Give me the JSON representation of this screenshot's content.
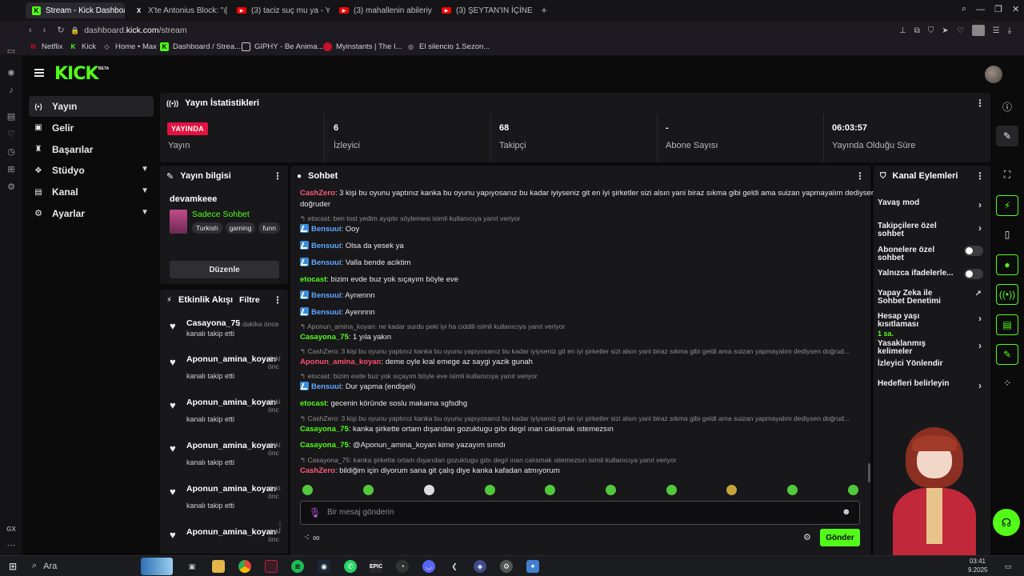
{
  "browser": {
    "tabs": [
      {
        "label": "Stream - Kick Dashboard",
        "favicon": "kick",
        "color": "#53fc18"
      },
      {
        "label": "X'te Antonius Block: \"@p",
        "favicon": "x",
        "color": "#ffffff"
      },
      {
        "label": "(3) taciz suç mu ya - You",
        "favicon": "youtube",
        "color": "#ff0000"
      },
      {
        "label": "(3) mahallenin abileriyik -",
        "favicon": "youtube",
        "color": "#ff0000"
      },
      {
        "label": "(3) ŞEYTAN'IN İÇİNE GİRD",
        "favicon": "youtube",
        "color": "#ff0000"
      }
    ],
    "url_host": "dashboard.",
    "url_domain": "kick.com",
    "url_path": "/stream",
    "bookmarks": [
      "Netflix",
      "Kick",
      "Home • Max",
      "Dashboard / Strea...",
      "GIPHY - Be Anima...",
      "Myinstants | The I...",
      "El silencio 1.Sezon..."
    ]
  },
  "brand": {
    "logo": "KICK",
    "beta": "BETA",
    "accent": "#53fc18"
  },
  "nav": [
    {
      "label": "Yayın",
      "icon": "broadcast-icon",
      "active": true
    },
    {
      "label": "Gelir",
      "icon": "revenue-icon"
    },
    {
      "label": "Başarılar",
      "icon": "trophy-icon"
    },
    {
      "label": "Stüdyo",
      "icon": "studio-icon",
      "expand": true
    },
    {
      "label": "Kanal",
      "icon": "channel-icon",
      "expand": true
    },
    {
      "label": "Ayarlar",
      "icon": "gear-icon",
      "expand": true
    }
  ],
  "stats": {
    "title": "Yayın İstatistikleri",
    "live_badge": "YAYINDA",
    "items": [
      {
        "value": "",
        "label": "Yayın"
      },
      {
        "value": "6",
        "label": "İzleyici"
      },
      {
        "value": "68",
        "label": "Takipçi"
      },
      {
        "value": "-",
        "label": "Abone Sayısı"
      },
      {
        "value": "06:03:57",
        "label": "Yayında Olduğu Süre"
      }
    ]
  },
  "stream_info": {
    "title": "Yayın bilgisi",
    "channel": "devamkeee",
    "category": "Sadece Sohbet",
    "tags": [
      "Turkish",
      "gaming",
      "funn"
    ],
    "edit_button": "Düzenle"
  },
  "activity": {
    "title": "Etkinlik Akışı",
    "filter": "Filtre",
    "items": [
      {
        "user": "Casayona_75",
        "time": "8 dakika önce",
        "text": "kanalı takip etti"
      },
      {
        "user": "Aponun_amina_koyan",
        "time": "daki\nönc",
        "text": "kanalı takip etti"
      },
      {
        "user": "Aponun_amina_koyan",
        "time": "daki\nönc",
        "text": "kanalı takip etti"
      },
      {
        "user": "Aponun_amina_koyan",
        "time": "daki\nönc",
        "text": "kanalı takip etti"
      },
      {
        "user": "Aponun_amina_koyan",
        "time": "daki\nönc",
        "text": "kanalı takip etti"
      },
      {
        "user": "Aponun_amina_koyan",
        "time": "daki\nönc",
        "text": ""
      }
    ]
  },
  "chat": {
    "title": "Sohbet",
    "messages": [
      {
        "kind": "msg",
        "user": "CashZero",
        "color": "#ff5a7a",
        "text": "3 kişi bu oyunu yaptınız kanka bu oyunu yapıyosanız bu kadar iyiyseniz git en iyi şirketler sizi alsın yani biraz sıkma gibi geldi ama suizan yapmayalım dediysen",
        "cont": "doğruder"
      },
      {
        "kind": "reply",
        "text": "etocast: ben tost yedim ayıptır söylemesi isimli kullanıcıya yanıt veriyor"
      },
      {
        "kind": "msg",
        "user": "Bensuui",
        "color": "#5fa8ff",
        "badge": true,
        "text": "Ooy"
      },
      {
        "kind": "msg",
        "user": "Bensuui",
        "color": "#5fa8ff",
        "badge": true,
        "text": "Olsa da yesek ya"
      },
      {
        "kind": "msg",
        "user": "Bensuui",
        "color": "#5fa8ff",
        "badge": true,
        "text": "Valla bende aciktim"
      },
      {
        "kind": "msg",
        "user": "etocast",
        "color": "#53fc18",
        "text": "bizim evde buz yok sıçayım böyle eve"
      },
      {
        "kind": "msg",
        "user": "Bensuui",
        "color": "#5fa8ff",
        "badge": true,
        "text": "Aynennn"
      },
      {
        "kind": "msg",
        "user": "Bensuui",
        "color": "#5fa8ff",
        "badge": true,
        "text": "Ayennnn"
      },
      {
        "kind": "reply",
        "text": "Aponun_amina_koyan: ne kadar surdu peki iyi ha ciddili isimli kullanıcıya yanıt veriyor"
      },
      {
        "kind": "msg",
        "user": "Casayona_75",
        "color": "#53fc18",
        "text": "1 yıla yakın"
      },
      {
        "kind": "reply",
        "text": "CashZero: 3 kişi bu oyunu yaptınız kanka bu oyunu yapıyosanız bu kadar iyiyseniz git en iyi şirketler sizi alsın yani biraz sıkma gibi geldi ama suizan yapmayalım dediysen doğrud..."
      },
      {
        "kind": "msg",
        "user": "Aponun_amina_koyan",
        "color": "#ff4d6d",
        "text": "deme oyle kral emege az saygi yazik gunah"
      },
      {
        "kind": "reply",
        "text": "etocast: bizim evde buz yok sıçayım böyle eve isimli kullanıcıya yanıt veriyor"
      },
      {
        "kind": "msg",
        "user": "Bensuui",
        "color": "#5fa8ff",
        "badge": true,
        "text": "Dur yapma (endişeli)"
      },
      {
        "kind": "msg",
        "user": "etocast",
        "color": "#53fc18",
        "text": "gecenin köründe soslu makarna sgfsdhg"
      },
      {
        "kind": "reply",
        "text": "CashZero: 3 kişi bu oyunu yaptınız kanka bu oyunu yapıyosanız bu kadar iyiyseniz git en iyi şirketler sizi alsın yani biraz sıkma gibi geldi ama suizan yapmayalım dediysen doğrud..."
      },
      {
        "kind": "msg",
        "user": "Casayona_75",
        "color": "#53fc18",
        "text": "kanka şirkette ortam dışarıdan gozuktugu gıbı degıl ınan calısmak ıstemezsın"
      },
      {
        "kind": "msg",
        "user": "Casayona_75",
        "color": "#53fc18",
        "text": "@Aponun_amina_koyan kime yazayım sımdı"
      },
      {
        "kind": "reply",
        "text": "Casayona_75: kanka şirkette ortam dışarıdan gozuktugu gıbı degıl ınan calısmak ıstemezsın isimli kullanıcıya yanıt veriyor"
      },
      {
        "kind": "msg",
        "user": "CashZero",
        "color": "#ff5a7a",
        "text": "bildiğim için diyorum sana git çalış diye kanka kafadan atmıyorum"
      }
    ],
    "input_placeholder": "Bir mesaj gönderin",
    "send_label": "Gönder"
  },
  "mod": {
    "title": "Kanal Eylemleri",
    "items": [
      {
        "label": "Yavaş mod",
        "type": "arrow"
      },
      {
        "label": "Takipçilere özel sohbet",
        "type": "arrow"
      },
      {
        "label": "Abonelere özel sohbet",
        "type": "toggle"
      },
      {
        "label": "Yalnızca ifadelerle...",
        "type": "toggle"
      },
      {
        "label": "Yapay Zeka ile Sohbet Denetimi",
        "type": "external"
      },
      {
        "label": "Hesap yaşı kısıtlaması",
        "sub": "1 sa.",
        "type": "arrow"
      },
      {
        "label": "Yasaklanmış kelimeler",
        "type": "arrow"
      },
      {
        "label": "İzleyici Yönlendir",
        "type": "none"
      },
      {
        "label": "Hedefleri belirleyin",
        "type": "arrow"
      }
    ]
  },
  "taskbar": {
    "search": "Ara",
    "time": "03:41",
    "date": "9.2025"
  }
}
